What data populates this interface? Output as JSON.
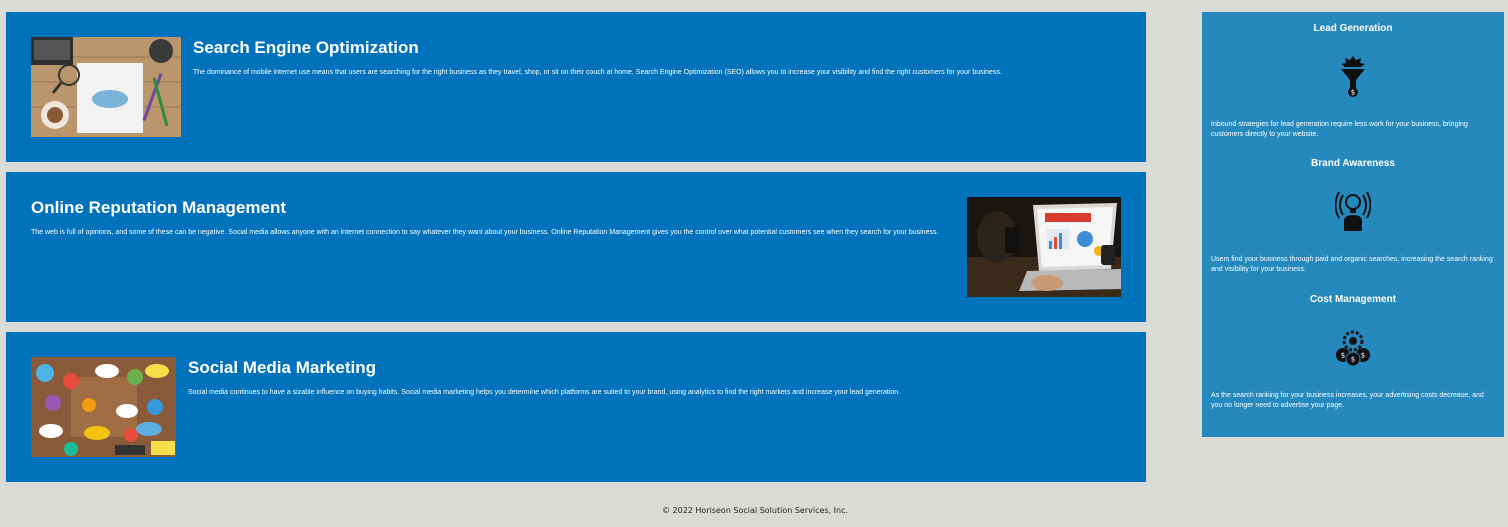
{
  "services": {
    "seo": {
      "title": "Search Engine Optimization",
      "text": "The dominance of mobile internet use means that users are searching for the right business as they travel, shop, or sit on their couch at home. Search Engine Optimization (SEO) allows you to increase your visibility and find the right customers for your business."
    },
    "orm": {
      "title": "Online Reputation Management",
      "text": "The web is full of opinions, and some of these can be negative. Social media allows anyone with an internet connection to say whatever they want about your business. Online Reputation Management gives you the control over what potential customers see when they search for your business."
    },
    "smm": {
      "title": "Social Media Marketing",
      "text": "Social media continues to have a sizable influence on buying habits. Social media marketing helps you determine which platforms are suited to your brand, using analytics to find the right markets and increase your lead generation."
    }
  },
  "benefits": {
    "lead": {
      "title": "Lead Generation",
      "icon": "lead-generation-icon",
      "text": "Inbound strategies for lead generation require less work for your business, bringing customers directly to your website."
    },
    "brand": {
      "title": "Brand Awareness",
      "icon": "brand-awareness-icon",
      "text": "Users find your business through paid and organic searches, increasing the search ranking and visibility for your business."
    },
    "cost": {
      "title": "Cost Management",
      "icon": "cost-management-icon",
      "text": "As the search ranking for your business increases, your advertising costs decrease, and you no longer need to advertise your page."
    }
  },
  "footer": {
    "copyright": "© 2022 Horiseon Social Solution Services, Inc."
  },
  "colors": {
    "page_background": "#d9dcd6",
    "card_background": "#0072bb",
    "benefits_background": "#2589bd",
    "text": "#ffffff"
  }
}
